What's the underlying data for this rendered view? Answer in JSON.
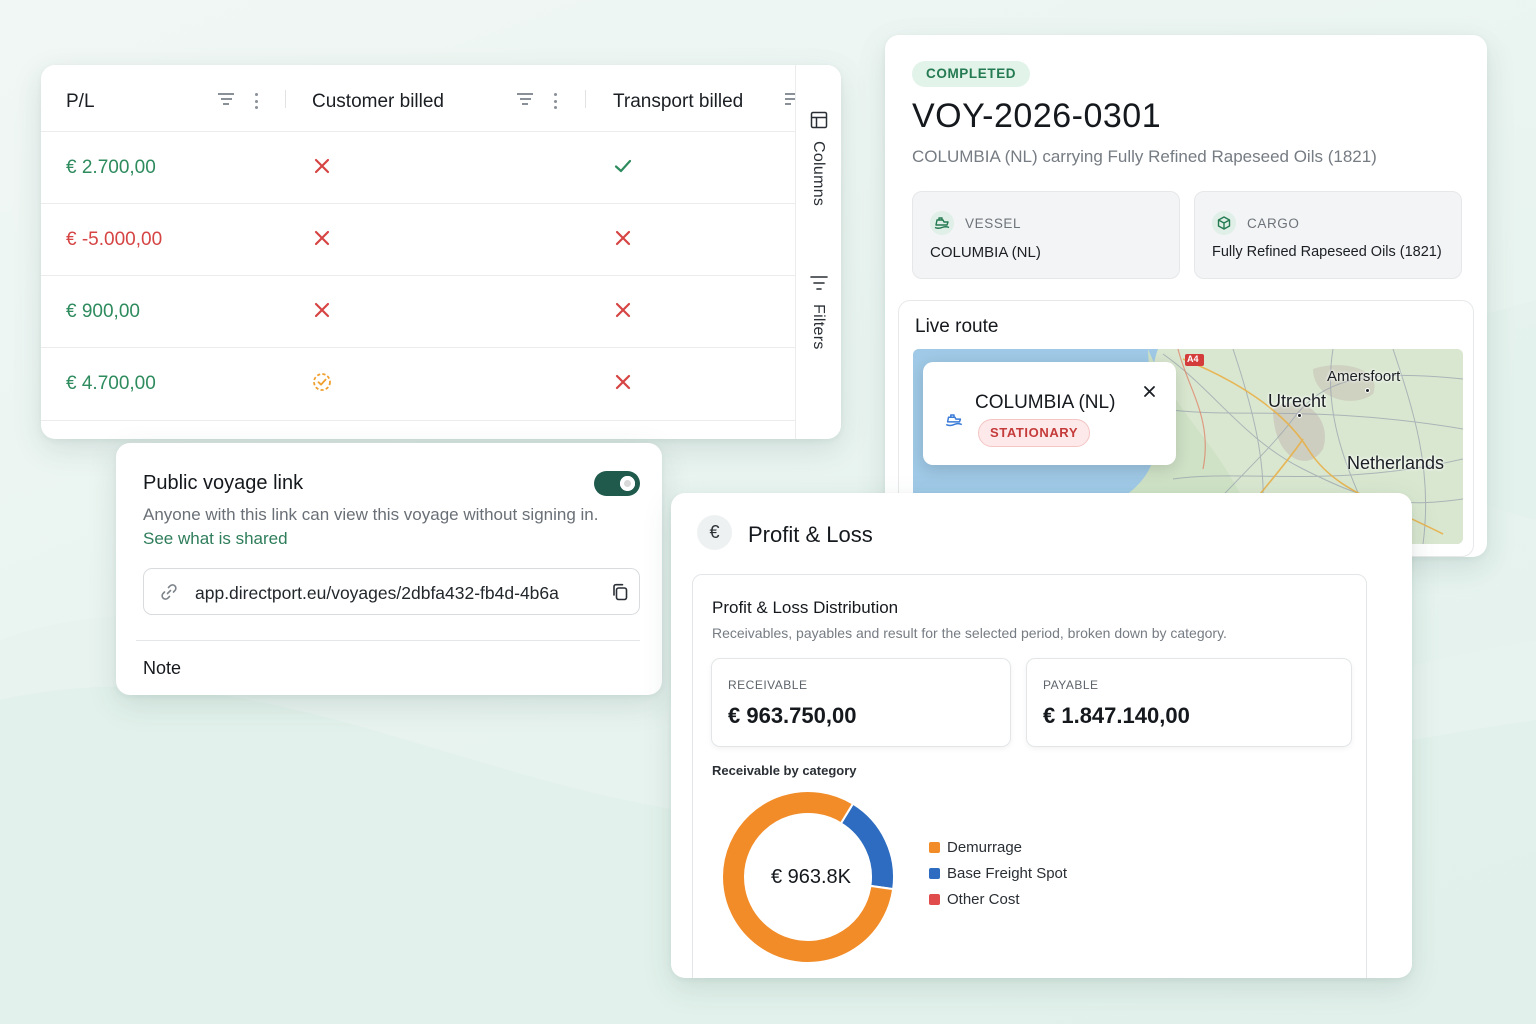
{
  "colors": {
    "positive": "#2e8b5e",
    "negative": "#d64444",
    "brand_dark_green": "#1f5a4c",
    "link_green": "#2e7d5b",
    "pending": "#f0a030",
    "demurrage": "#f28c28",
    "base_freight": "#2d6cc0",
    "other_cost": "#e04b4b"
  },
  "table": {
    "columns": [
      "P/L",
      "Customer billed",
      "Transport billed"
    ],
    "rows": [
      {
        "pl": "€ 2.700,00",
        "sign": "positive",
        "customer_billed": "x-icon",
        "transport_billed": "check-icon"
      },
      {
        "pl": "€ -5.000,00",
        "sign": "negative",
        "customer_billed": "x-icon",
        "transport_billed": "x-icon"
      },
      {
        "pl": "€ 900,00",
        "sign": "positive",
        "customer_billed": "x-icon",
        "transport_billed": "x-icon"
      },
      {
        "pl": "€ 4.700,00",
        "sign": "positive",
        "customer_billed": "pending-check-icon",
        "transport_billed": "x-icon"
      }
    ],
    "side_buttons": {
      "columns": "Columns",
      "filters": "Filters"
    }
  },
  "public_link": {
    "title": "Public voyage link",
    "toggle_on": true,
    "description": "Anyone with this link can view this voyage without signing in.",
    "see_shared": "See what is shared",
    "url": "app.directport.eu/voyages/2dbfa432-fb4d-4b6a",
    "note_label": "Note"
  },
  "voyage": {
    "status": "COMPLETED",
    "id": "VOY-2026-0301",
    "subtitle": "COLUMBIA (NL) carrying Fully Refined Rapeseed Oils (1821)",
    "vessel_caption": "VESSEL",
    "vessel": "COLUMBIA (NL)",
    "cargo_caption": "CARGO",
    "cargo": "Fully Refined Rapeseed Oils (1821)",
    "live_route_title": "Live route",
    "popup_vessel": "COLUMBIA (NL)",
    "popup_status": "STATIONARY",
    "map_labels": {
      "road": "A4",
      "amersfoort": "Amersfoort",
      "utrecht": "Utrecht",
      "netherlands": "Netherlands"
    }
  },
  "profit_loss": {
    "title": "Profit & Loss",
    "euro_symbol": "€",
    "dist_title": "Profit & Loss Distribution",
    "dist_subtitle": "Receivables, payables and result for the selected period, broken down by category.",
    "receivable_caption": "RECEIVABLE",
    "receivable_value": "€ 963.750,00",
    "payable_caption": "PAYABLE",
    "payable_value": "€ 1.847.140,00",
    "category_title": "Receivable by category",
    "donut_center": "€ 963.8K"
  },
  "chart_data": {
    "type": "pie",
    "title": "Receivable by category",
    "center_label": "€ 963.8K",
    "categories": [
      "Demurrage",
      "Base Freight Spot",
      "Other Cost"
    ],
    "values": [
      81.5,
      18.5,
      0
    ],
    "value_unit": "percent of receivable (estimated)",
    "legend_position": "right"
  }
}
